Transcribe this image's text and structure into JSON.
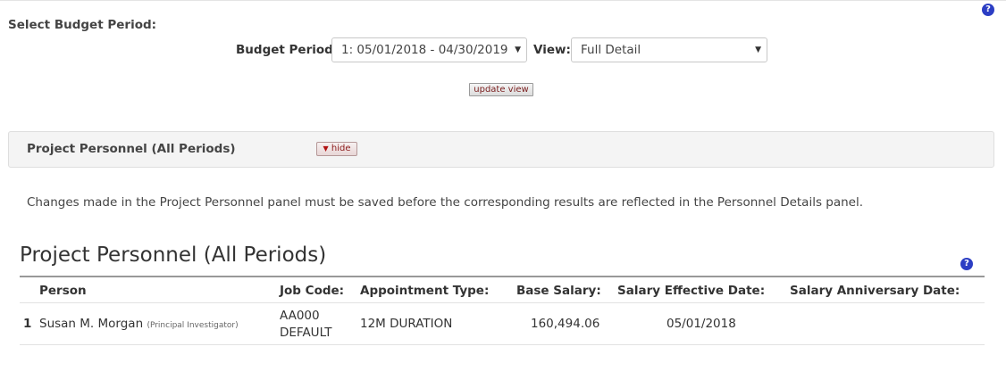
{
  "page": {
    "section_title": "Select Budget Period:",
    "help_icon": "question-circle-icon"
  },
  "filters": {
    "budget_period_label": "Budget Period:",
    "budget_period_value": "1: 05/01/2018 - 04/30/2019",
    "view_label": "View:",
    "view_value": "Full Detail",
    "update_button": "update view"
  },
  "panel": {
    "title": "Project Personnel (All Periods)",
    "hide_button": "hide",
    "note": "Changes made in the Project Personnel panel must be saved before the corresponding results are reflected in the Personnel Details panel."
  },
  "personnel": {
    "heading": "Project Personnel (All Periods)",
    "columns": {
      "person": "Person",
      "job_code": "Job Code:",
      "appointment_type": "Appointment Type:",
      "base_salary": "Base Salary:",
      "effective_date": "Salary Effective Date:",
      "anniversary_date": "Salary Anniversary Date:"
    },
    "rows": [
      {
        "index": "1",
        "name": "Susan M. Morgan",
        "role": "(Principal Investigator)",
        "job_code_line1": "AA000",
        "job_code_line2": "DEFAULT",
        "appointment_type": "12M DURATION",
        "base_salary": "160,494.06",
        "effective_date": "05/01/2018",
        "anniversary_date": ""
      }
    ]
  }
}
